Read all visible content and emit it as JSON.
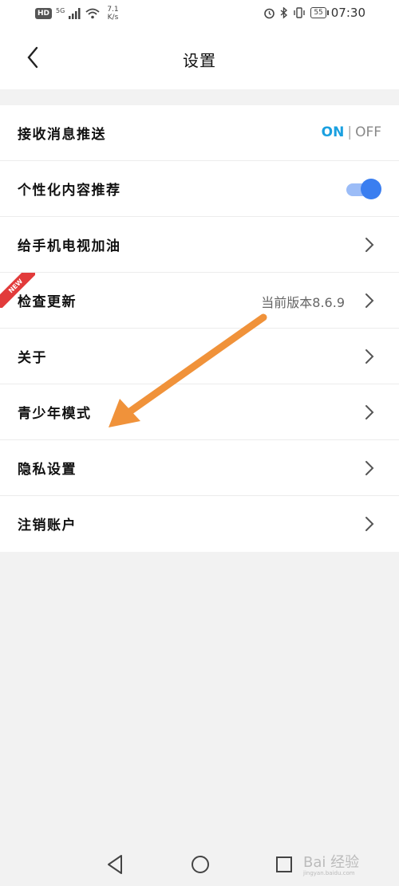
{
  "status_bar": {
    "hd": "HD",
    "network": "5G",
    "speed_value": "7.1",
    "speed_unit": "K/s",
    "battery": "55",
    "time": "07:30"
  },
  "header": {
    "title": "设置",
    "back_icon": "chevron-left-icon"
  },
  "settings": {
    "push": {
      "label": "接收消息推送",
      "on": "ON",
      "sep": "|",
      "off": "OFF"
    },
    "personalized": {
      "label": "个性化内容推荐",
      "enabled": true
    },
    "cheer": {
      "label": "给手机电视加油"
    },
    "update": {
      "label": "检查更新",
      "badge": "NEW",
      "version": "当前版本8.6.9"
    },
    "about": {
      "label": "关于"
    },
    "teen": {
      "label": "青少年模式"
    },
    "privacy": {
      "label": "隐私设置"
    },
    "cancel": {
      "label": "注销账户"
    }
  },
  "colors": {
    "accent_on": "#1aa0e0",
    "toggle_active": "#3a7ef0",
    "new_badge": "#e23b3b",
    "annotation_arrow": "#f0923a"
  },
  "watermark": {
    "text": "Bai 经验",
    "sub": "jingyan.baidu.com"
  }
}
